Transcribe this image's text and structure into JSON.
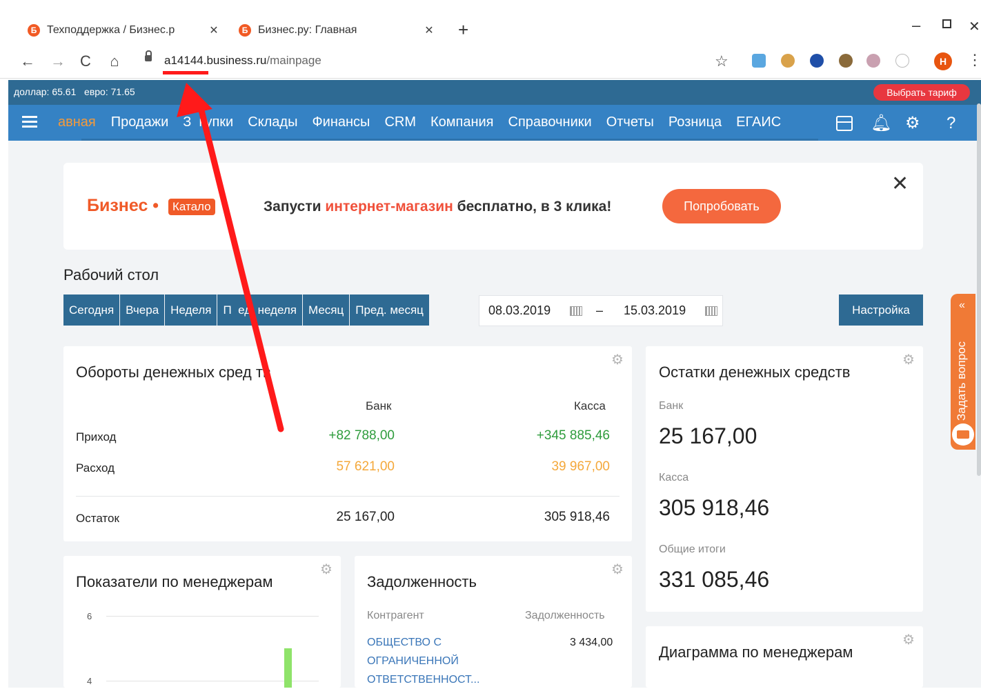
{
  "browser": {
    "tabs": [
      {
        "favicon": "Б",
        "title": "Техподдержка / Бизнес.р"
      },
      {
        "favicon": "Б",
        "title": "Бизнес.ру: Главная"
      }
    ],
    "new_tab_icon": "+",
    "url_host": "a14144.business.ru",
    "url_path": "/mainpage",
    "profile_initial": "Н"
  },
  "rates": {
    "text": "доллар: 65.61   евро: 71.65"
  },
  "tariff_button": "Выбрать тариф",
  "nav": {
    "items": [
      "авная",
      "Продажи",
      "З  купки",
      "Склады",
      "Финансы",
      "CRM",
      "Компания",
      "Справочники",
      "Отчеты",
      "Розница",
      "ЕГАИС"
    ]
  },
  "promo": {
    "logo_main": "Бизнес •",
    "logo_badge": "Катало",
    "text_before": "Запусти ",
    "text_highlight": "интернет-магазин",
    "text_after": " бесплатно, в 3 клика!",
    "button": "Попробовать"
  },
  "desktop": {
    "title": "Рабочий стол",
    "periods": [
      "Сегодня",
      "Вчера",
      "Неделя",
      "П  ед. неделя",
      "Месяц",
      "Пред. месяц"
    ],
    "date_from": "08.03.2019",
    "date_sep": "–",
    "date_to": "15.03.2019",
    "settings": "Настройка"
  },
  "cashflow": {
    "title": "Обороты денежных сред  тв",
    "col_bank": "Банк",
    "col_cash": "Касса",
    "rows": [
      {
        "label": "Приход",
        "bank": "+82 788,00",
        "cash": "+345 885,46"
      },
      {
        "label": "Расход",
        "bank": "57 621,00",
        "cash": "39 967,00"
      },
      {
        "label": "Остаток",
        "bank": "25 167,00",
        "cash": "305 918,46"
      }
    ]
  },
  "balances": {
    "title": "Остатки денежных средств",
    "bank_label": "Банк",
    "bank_value": "25 167,00",
    "cash_label": "Касса",
    "cash_value": "305 918,46",
    "total_label": "Общие итоги",
    "total_value": "331 085,46"
  },
  "managers": {
    "title": "Показатели по менеджерам",
    "tick_top": "6",
    "tick_bottom": "4"
  },
  "debt": {
    "title": "Задолженность",
    "col_party": "Контрагент",
    "col_debt": "Задолженность",
    "party_lines": [
      "ОБЩЕСТВО С",
      "ОГРАНИЧЕННОЙ",
      "ОТВЕТСТВЕННОСТ..."
    ],
    "amount": "3 434,00"
  },
  "diagram": {
    "title": "Диаграмма по менеджерам"
  },
  "ask_tab": {
    "text": "Задать вопрос",
    "arrow": "«"
  },
  "colors": {
    "rates_bar": "#2e6a93",
    "nav_bar": "#3582c4",
    "accent_orange": "#f05a28",
    "annotation_red": "#ff1a1a"
  }
}
